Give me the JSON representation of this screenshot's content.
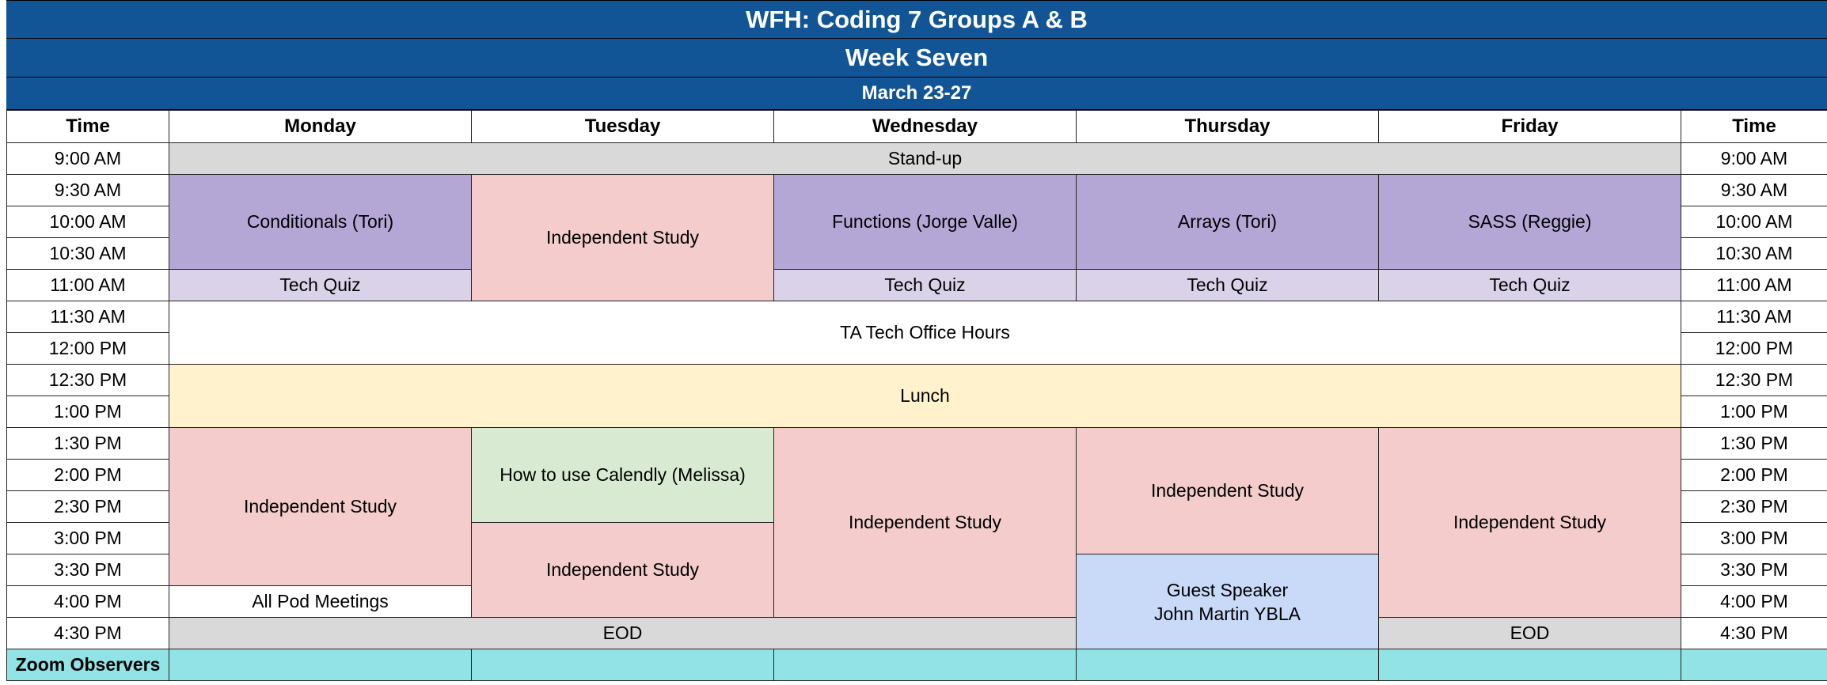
{
  "header": {
    "title": "WFH: Coding 7 Groups A & B",
    "week": "Week Seven",
    "dates": "March 23-27"
  },
  "columns": {
    "time": "Time",
    "monday": "Monday",
    "tuesday": "Tuesday",
    "wednesday": "Wednesday",
    "thursday": "Thursday",
    "friday": "Friday",
    "time_right": "Time"
  },
  "times": [
    "9:00 AM",
    "9:30 AM",
    "10:00 AM",
    "10:30 AM",
    "11:00 AM",
    "11:30 AM",
    "12:00 PM",
    "12:30 PM",
    "1:00 PM",
    "1:30 PM",
    "2:00 PM",
    "2:30 PM",
    "3:00 PM",
    "3:30 PM",
    "4:00 PM",
    "4:30 PM"
  ],
  "events": {
    "standup": "Stand-up",
    "mon_conditionals": "Conditionals (Tori)",
    "tue_independent_am": "Independent Study",
    "wed_functions": "Functions (Jorge Valle)",
    "thu_arrays": "Arrays (Tori)",
    "fri_sass": "SASS (Reggie)",
    "tech_quiz": "Tech Quiz",
    "ta_office_hours": "TA Tech Office Hours",
    "lunch": "Lunch",
    "mon_independent_pm": "Independent Study",
    "tue_calendly": "How to use Calendly (Melissa)",
    "wed_independent_pm": "Independent Study",
    "thu_independent_pm": "Independent Study",
    "fri_independent_pm": "Independent Study",
    "tue_independent_late": "Independent Study",
    "guest_speaker_line1": "Guest Speaker",
    "guest_speaker_line2": "John Martin YBLA",
    "all_pod_meetings": "All Pod Meetings",
    "eod": "EOD",
    "eod_friday": "EOD"
  },
  "footer": {
    "zoom_observers": "Zoom Observers"
  },
  "colors": {
    "header_blue": "#125597",
    "gray": "#d9d9d9",
    "purple": "#b4a7d6",
    "light_purple": "#d9d2e9",
    "pink": "#f4cccc",
    "green": "#d9ead3",
    "yellow": "#fff2cc",
    "blue": "#c9daf8",
    "cyan": "#92e3e6"
  }
}
